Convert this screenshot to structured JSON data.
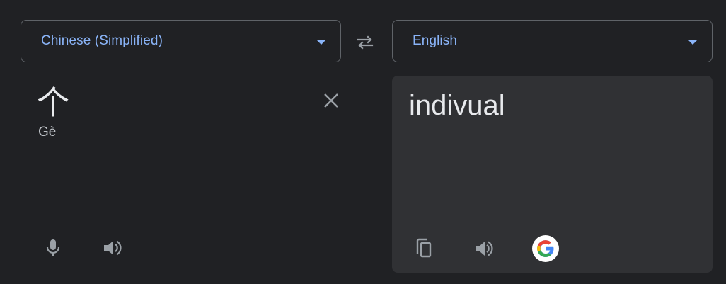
{
  "source_language": {
    "label": "Chinese (Simplified)"
  },
  "target_language": {
    "label": "English"
  },
  "source": {
    "text": "个",
    "transliteration": "Gè"
  },
  "target": {
    "text": "indivual"
  },
  "icons": {
    "swap": "swap-arrows-icon",
    "clear": "close-icon",
    "mic": "microphone-icon",
    "speaker": "speaker-icon",
    "copy": "copy-icon",
    "google": "google-logo-icon"
  },
  "colors": {
    "background": "#202124",
    "panel": "#303134",
    "accent": "#8ab4f8",
    "text": "#e8eaed",
    "icon": "#9aa0a6",
    "border": "#5f6368"
  }
}
